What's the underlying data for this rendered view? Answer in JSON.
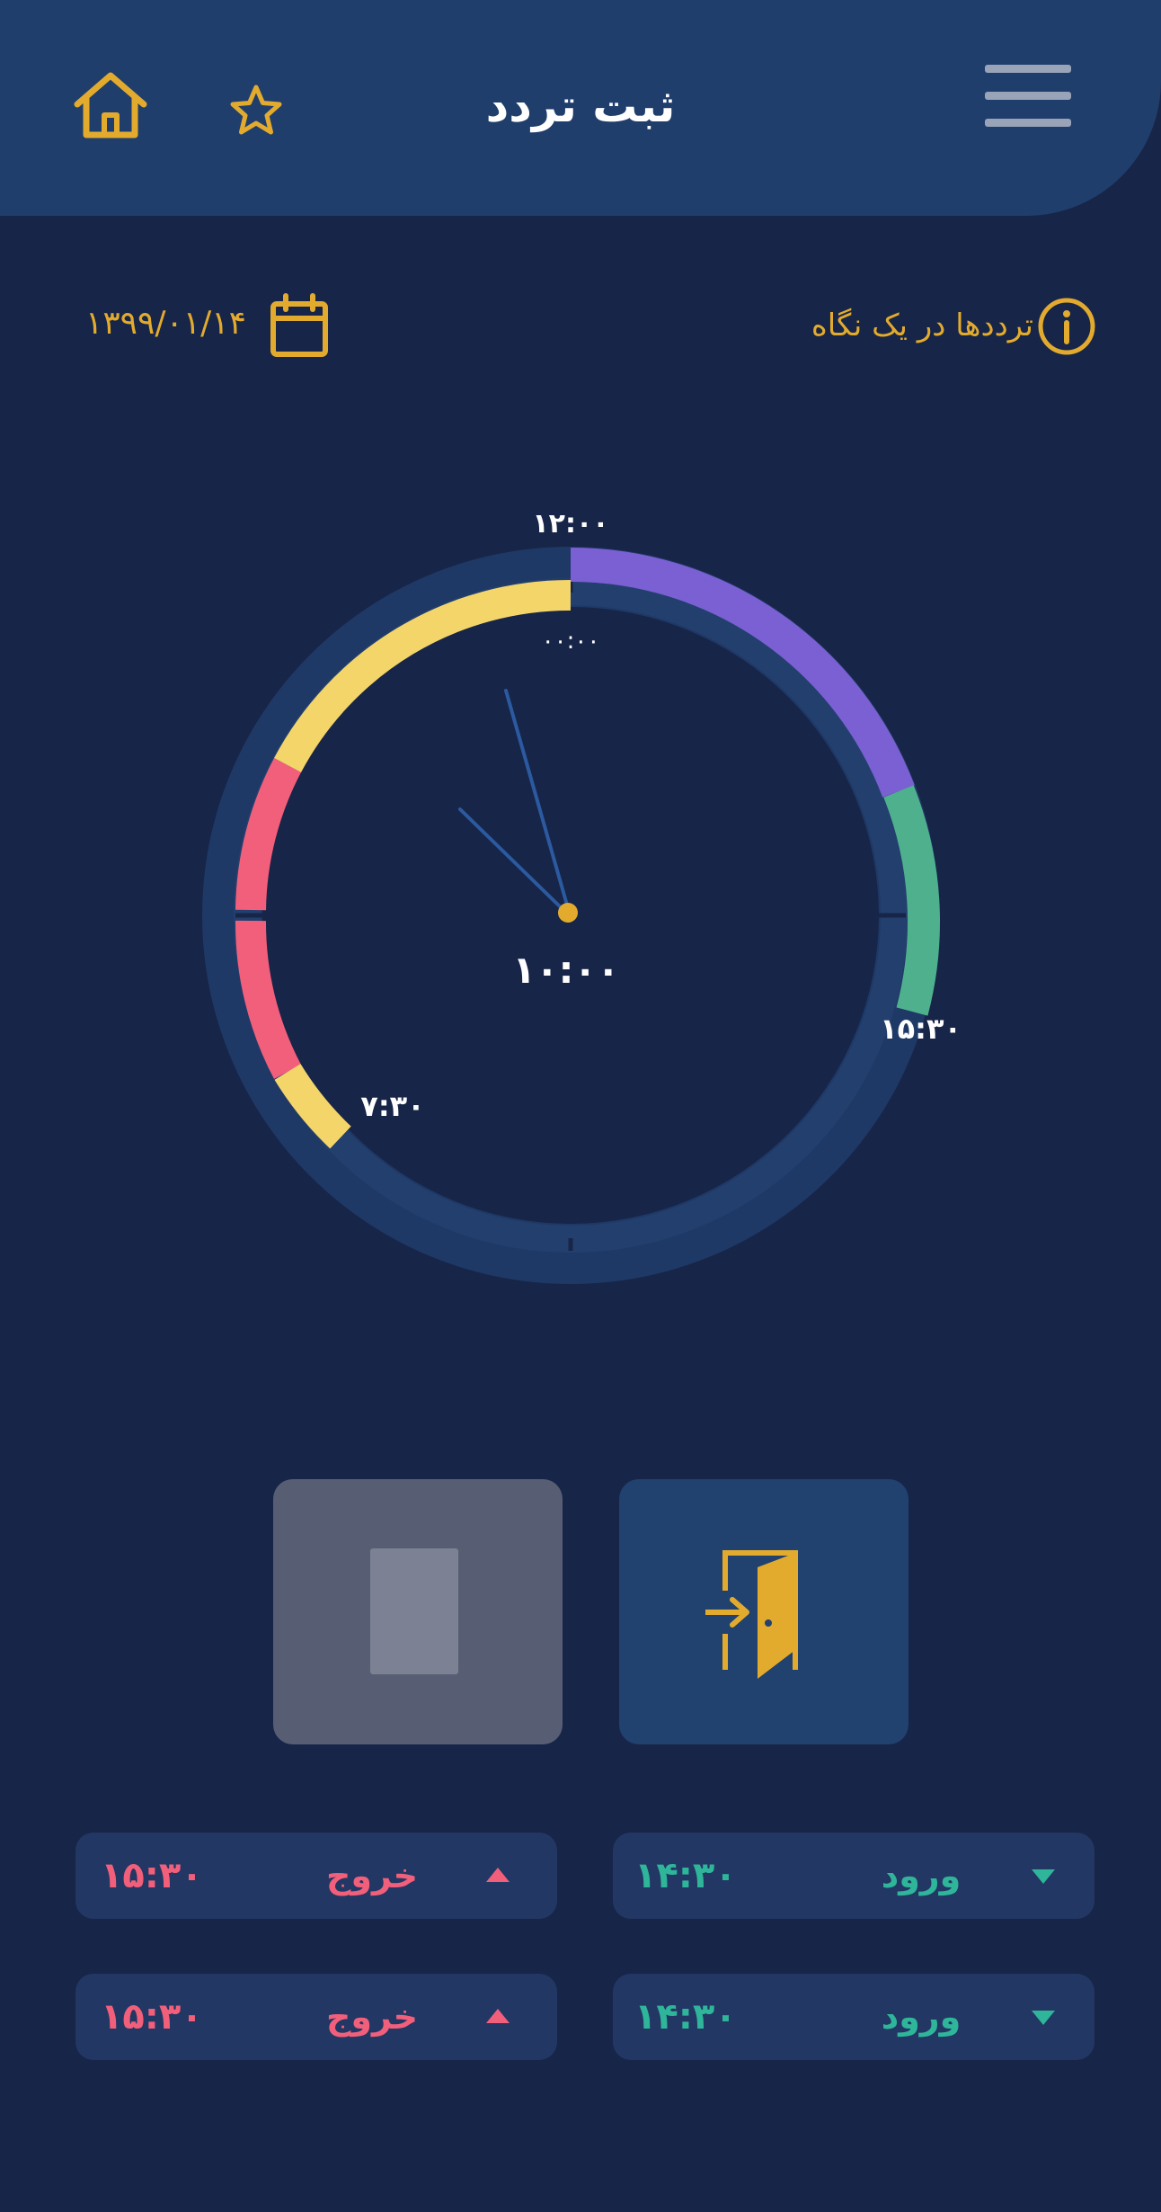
{
  "header": {
    "title": "ثبت تردد",
    "home_icon": "home-icon",
    "favorite_icon": "star-icon",
    "menu_icon": "hamburger-menu-icon"
  },
  "date_bar": {
    "date": "۱۳۹۹/۰۱/۱۴",
    "calendar_icon": "calendar-icon",
    "info_label": "ترددها در یک نگاه",
    "info_icon": "info-icon"
  },
  "clock": {
    "top_outer_label": "۱۲:۰۰",
    "top_inner_label": "۰۰:۰۰",
    "center_time": "۱۰:۰۰",
    "label_right": "۱۵:۳۰",
    "label_left": "۷:۳۰",
    "colors": {
      "purple": "#7a60d3",
      "green": "#4fb08e",
      "red": "#f25f7b",
      "yellow": "#f4d56a",
      "track": "#223b69",
      "hand": "#2b5aa0",
      "pivot": "#e3ab2e"
    }
  },
  "actions": {
    "stop_icon": "stop-icon",
    "enter_icon": "door-enter-icon"
  },
  "logs": [
    {
      "entry_label": "ورود",
      "entry_time": "۱۴:۳۰",
      "exit_label": "خروج",
      "exit_time": "۱۵:۳۰"
    },
    {
      "entry_label": "ورود",
      "entry_time": "۱۴:۳۰",
      "exit_label": "خروج",
      "exit_time": "۱۵:۳۰"
    }
  ],
  "colors": {
    "background": "#172548",
    "header": "#203e6c",
    "accent": "#e3ab2e",
    "entry": "#2fb59a",
    "exit": "#f25f7b"
  }
}
